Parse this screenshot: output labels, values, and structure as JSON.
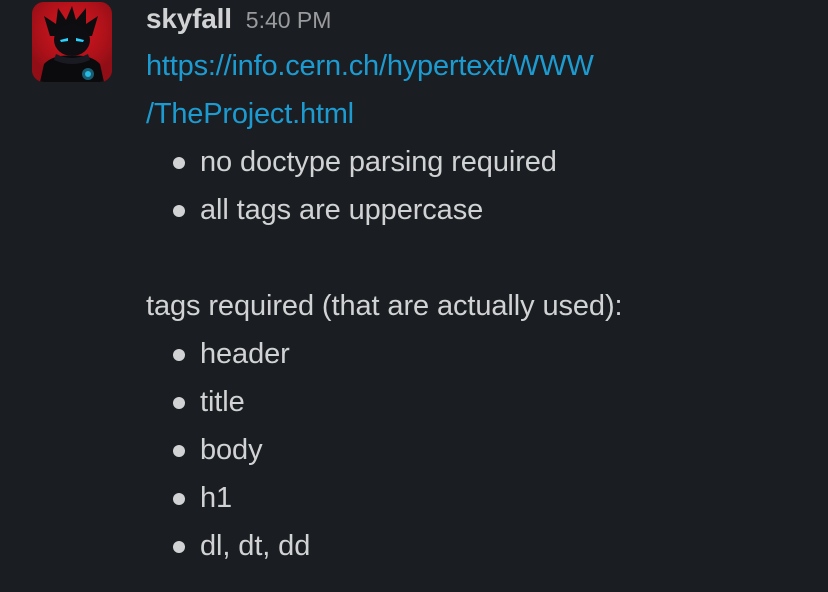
{
  "message": {
    "username": "skyfall",
    "timestamp": "5:40 PM",
    "link_line1": "https://info.cern.ch/hypertext/WWW",
    "link_line2": "/TheProject.html",
    "list1": [
      "no doctype parsing required",
      "all tags are uppercase"
    ],
    "paragraph": "tags required (that are actually used):",
    "list2": [
      "header",
      "title",
      "body",
      "h1",
      "dl, dt, dd"
    ]
  },
  "colors": {
    "background": "#1a1d21",
    "text": "#d1d2d3",
    "timestamp": "#9a9b9e",
    "link": "#1d9bd1",
    "avatar_bg": "#c8141e",
    "avatar_eyes": "#29d3ff"
  },
  "icons": {
    "avatar": "ninja-avatar-icon"
  }
}
